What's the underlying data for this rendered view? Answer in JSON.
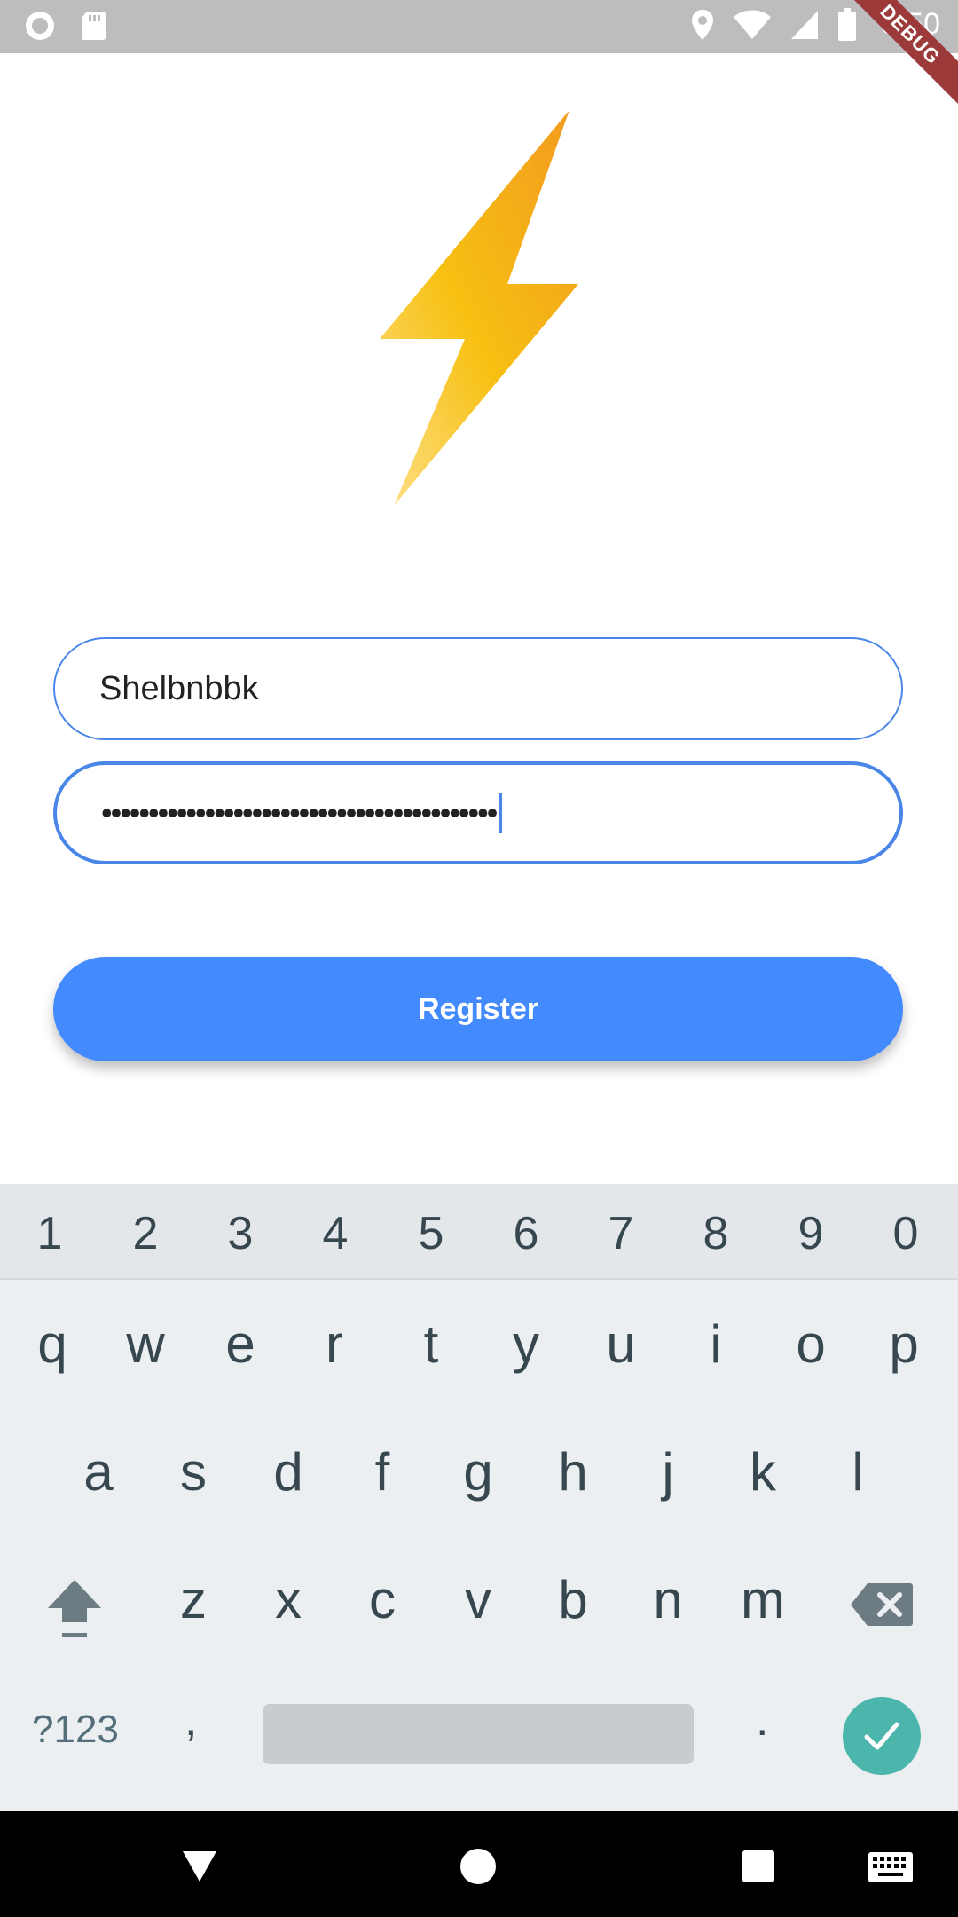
{
  "status_bar": {
    "time": "8:50",
    "debug_label": "DEBUG",
    "icons": [
      "circle-notification-icon",
      "sd-card-icon",
      "location-icon",
      "wifi-icon",
      "signal-icon",
      "battery-icon"
    ]
  },
  "logo": {
    "icon": "lightning-bolt-icon",
    "colors": [
      "#f5a623",
      "#f7c02a",
      "#fbd66b"
    ]
  },
  "form": {
    "username_value": "Shelbnbbk",
    "password_value": "••••••••••••••••••••••••••••••••••••••••••",
    "register_label": "Register",
    "accent_color": "#448aff"
  },
  "keyboard": {
    "numbers": [
      "1",
      "2",
      "3",
      "4",
      "5",
      "6",
      "7",
      "8",
      "9",
      "0"
    ],
    "row1": [
      "q",
      "w",
      "e",
      "r",
      "t",
      "y",
      "u",
      "i",
      "o",
      "p"
    ],
    "row2": [
      "a",
      "s",
      "d",
      "f",
      "g",
      "h",
      "j",
      "k",
      "l"
    ],
    "row3": [
      "z",
      "x",
      "c",
      "v",
      "b",
      "n",
      "m"
    ],
    "symbols_label": "?123",
    "comma_label": ",",
    "period_label": ".",
    "enter_icon": "check-icon",
    "enter_color": "#4db6ac"
  },
  "nav_bar": {
    "icons": [
      "back-icon",
      "home-icon",
      "recents-icon",
      "keyboard-switch-icon"
    ]
  }
}
